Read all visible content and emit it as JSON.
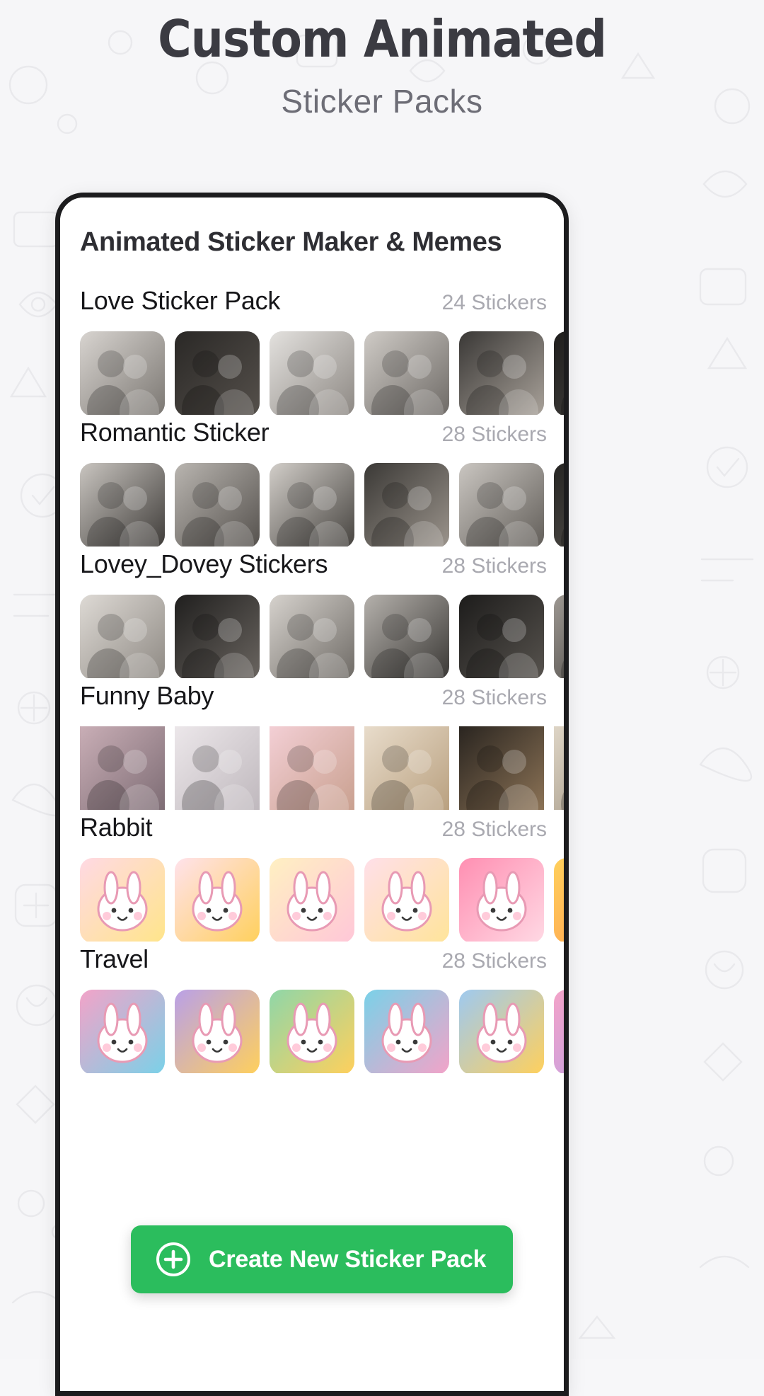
{
  "header": {
    "title": "Custom Animated",
    "subtitle": "Sticker Packs"
  },
  "app": {
    "title": "Animated Sticker Maker & Memes"
  },
  "cta": {
    "label": "Create New Sticker Pack",
    "icon": "plus-circle-icon",
    "background": "#2bbd5d",
    "text_color": "#ffffff"
  },
  "packs": [
    {
      "name": "Love Sticker Pack",
      "count": "24 Stickers",
      "thumb_style": "rounded",
      "palette": "mono",
      "thumbs": [
        {
          "a": "#d8d4d0",
          "b": "#7b7772"
        },
        {
          "a": "#2a2826",
          "b": "#55504b"
        },
        {
          "a": "#e3e1de",
          "b": "#8d8883"
        },
        {
          "a": "#cfcbc6",
          "b": "#6e6a66"
        },
        {
          "a": "#3a3836",
          "b": "#a9a29a"
        },
        {
          "a": "#1f1e1d",
          "b": "#4a4845"
        }
      ]
    },
    {
      "name": "Romantic Sticker",
      "count": "28 Stickers",
      "thumb_style": "rounded",
      "palette": "mono",
      "thumbs": [
        {
          "a": "#c9c5c0",
          "b": "#3f3c39"
        },
        {
          "a": "#b9b5b0",
          "b": "#55514d"
        },
        {
          "a": "#d2cec9",
          "b": "#46433f"
        },
        {
          "a": "#3b3936",
          "b": "#9b948c"
        },
        {
          "a": "#cac6c1",
          "b": "#625e59"
        },
        {
          "a": "#262523",
          "b": "#5c5853"
        }
      ]
    },
    {
      "name": "Lovey_Dovey Stickers",
      "count": "28 Stickers",
      "thumb_style": "rounded",
      "palette": "mono",
      "thumbs": [
        {
          "a": "#dedad5",
          "b": "#8e8983"
        },
        {
          "a": "#201f1e",
          "b": "#6a6560"
        },
        {
          "a": "#d6d2cd",
          "b": "#6f6b66"
        },
        {
          "a": "#b5b1ac",
          "b": "#3a3835"
        },
        {
          "a": "#1d1c1b",
          "b": "#57534e"
        },
        {
          "a": "#9d9892",
          "b": "#413e3b"
        }
      ]
    },
    {
      "name": "Funny Baby",
      "count": "28 Stickers",
      "thumb_style": "square",
      "palette": "color",
      "thumbs": [
        {
          "a": "#c9aeb6",
          "b": "#7d6c74"
        },
        {
          "a": "#ece7ea",
          "b": "#bfb8bd"
        },
        {
          "a": "#f3cfd5",
          "b": "#c9a08f"
        },
        {
          "a": "#e8dccb",
          "b": "#b9a07f"
        },
        {
          "a": "#2a2520",
          "b": "#8c7356"
        },
        {
          "a": "#ded5c6",
          "b": "#9b8f7d"
        }
      ]
    },
    {
      "name": "Rabbit",
      "count": "28 Stickers",
      "thumb_style": "plain",
      "palette": "cartoon",
      "thumbs": [
        {
          "a": "#ffd9e4",
          "b": "#ffe58a"
        },
        {
          "a": "#ffe2ec",
          "b": "#ffd05c"
        },
        {
          "a": "#fff0c2",
          "b": "#ffc7d8"
        },
        {
          "a": "#ffdfe9",
          "b": "#ffe49a"
        },
        {
          "a": "#ff8fb2",
          "b": "#ffd9e4"
        },
        {
          "a": "#ffd05c",
          "b": "#ff9a4d"
        }
      ]
    },
    {
      "name": "Travel",
      "count": "28 Stickers",
      "thumb_style": "plain",
      "palette": "cartoon",
      "thumbs": [
        {
          "a": "#f3a3c8",
          "b": "#7ad1e8"
        },
        {
          "a": "#b9a0e8",
          "b": "#ffd05c"
        },
        {
          "a": "#8fd6a8",
          "b": "#ffd05c"
        },
        {
          "a": "#7ad1e8",
          "b": "#f3a3c8"
        },
        {
          "a": "#9ec9f0",
          "b": "#ffd05c"
        },
        {
          "a": "#f3a3c8",
          "b": "#b9a0e8"
        }
      ]
    }
  ]
}
